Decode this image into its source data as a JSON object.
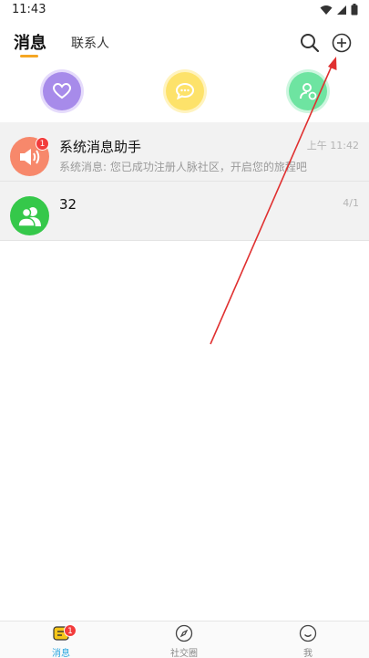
{
  "status_bar": {
    "time": "11:43"
  },
  "header": {
    "tabs": [
      {
        "label": "消息",
        "active": true
      },
      {
        "label": "联系人",
        "active": false
      }
    ],
    "accent_color": "#f5a623"
  },
  "quick_actions": [
    {
      "icon": "heart-icon",
      "color": "#a78bea"
    },
    {
      "icon": "chat-bubble-icon",
      "color": "#fde26a"
    },
    {
      "icon": "add-contact-icon",
      "color": "#6ee4a1"
    }
  ],
  "conversations": [
    {
      "title": "系统消息助手",
      "preview": "系统消息: 您已成功注册人脉社区，开启您的旅程吧",
      "time": "上午 11:42",
      "unread": "1",
      "avatar_icon": "speaker-icon",
      "avatar_color": "#f7886b"
    },
    {
      "title": "32",
      "preview": "",
      "time": "4/1",
      "avatar_icon": "group-icon",
      "avatar_color": "#35c84a"
    }
  ],
  "bottom_nav": [
    {
      "label": "消息",
      "icon": "message-icon",
      "badge": "1",
      "active": true
    },
    {
      "label": "社交圈",
      "icon": "compass-icon",
      "active": false
    },
    {
      "label": "我",
      "icon": "smiley-icon",
      "active": false
    }
  ],
  "annotation": {
    "color": "#e03030"
  }
}
